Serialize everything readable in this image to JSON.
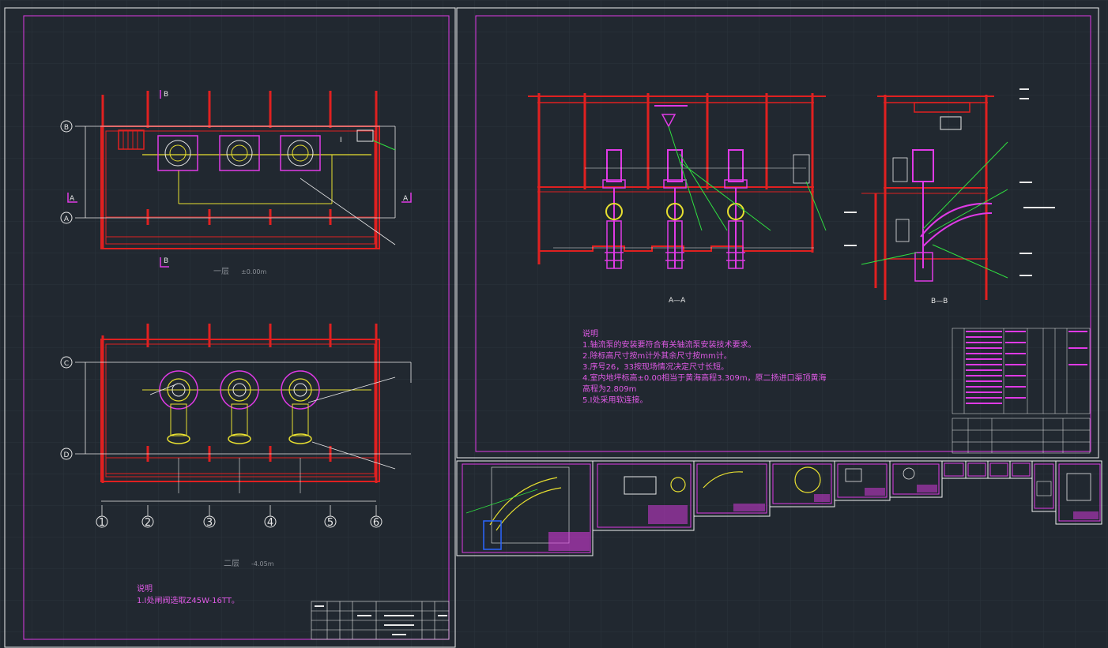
{
  "grid_labels": {
    "rows_top": [
      "B",
      "A"
    ],
    "rows_bottom": [
      "C",
      "D"
    ],
    "columns": [
      "1",
      "2",
      "3",
      "4",
      "5",
      "6"
    ]
  },
  "section_markers": {
    "b_top": "B",
    "b_bottom": "B",
    "a_left": "A",
    "a_right": "A",
    "cut_label": "I"
  },
  "plan_top": {
    "title": "一层",
    "elevation": "±0.00m"
  },
  "plan_bottom": {
    "title": "二层",
    "elevation": "-4.05m"
  },
  "left_notes": {
    "heading": "说明",
    "lines": [
      "1.I处闸阀选取Z45W-16TT。"
    ]
  },
  "right_notes": {
    "heading": "说明",
    "lines": [
      "1.轴流泵的安装要符合有关轴流泵安装技术要求。",
      "2.除标高尺寸按m计外其余尺寸按mm计。",
      "3.序号26，33按现场情况决定尺寸长短。",
      "4.室内地坪标高±0.00相当于黄海高程3.309m，原二扬进口渠顶黄海",
      "高程为2.809m",
      "5.I处采用软连接。"
    ]
  },
  "section_titles": {
    "aa": "A—A",
    "bb": "B—B"
  },
  "colors": {
    "background": "#212830",
    "frame": "#e03ae6",
    "wall": "#e02020",
    "pipe": "#e8e030",
    "leader": "#30e040",
    "text": "#e8e8e8",
    "note": "#e05ae6"
  }
}
